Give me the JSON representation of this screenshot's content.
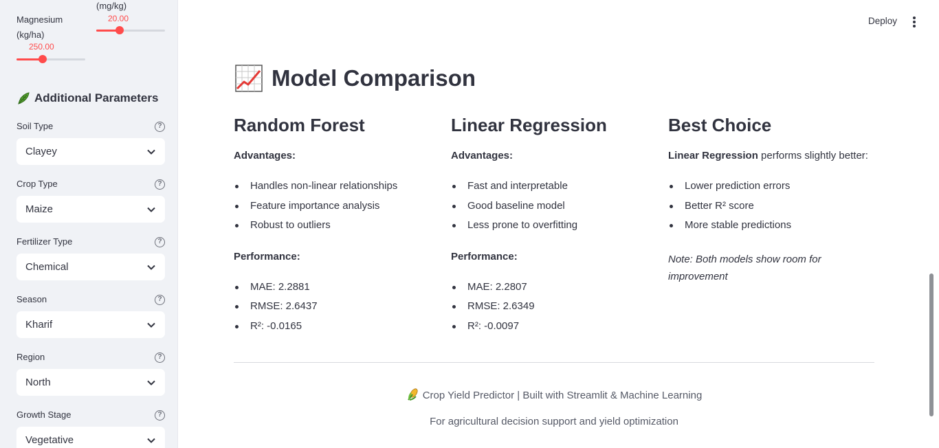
{
  "sidebar": {
    "sliders": [
      {
        "label_line1": "",
        "label_line2": "(mg/kg)",
        "value": "20.00",
        "fraction": 0.33
      },
      {
        "label_line1": "Magnesium",
        "label_line2": "(kg/ha)",
        "value": "250.00",
        "fraction": 0.38
      }
    ],
    "section_title": "Additional Parameters",
    "fields": [
      {
        "label": "Soil Type",
        "value": "Clayey"
      },
      {
        "label": "Crop Type",
        "value": "Maize"
      },
      {
        "label": "Fertilizer Type",
        "value": "Chemical"
      },
      {
        "label": "Season",
        "value": "Kharif"
      },
      {
        "label": "Region",
        "value": "North"
      },
      {
        "label": "Growth Stage",
        "value": "Vegetative"
      }
    ],
    "help_glyph": "?"
  },
  "header": {
    "deploy_label": "Deploy"
  },
  "main": {
    "title": "Model Comparison",
    "columns": [
      {
        "heading": "Random Forest",
        "advantages_label": "Advantages:",
        "advantages": [
          "Handles non-linear relationships",
          "Feature importance analysis",
          "Robust to outliers"
        ],
        "performance_label": "Performance:",
        "performance": [
          "MAE: 2.2881",
          "RMSE: 2.6437",
          "R²: -0.0165"
        ]
      },
      {
        "heading": "Linear Regression",
        "advantages_label": "Advantages:",
        "advantages": [
          "Fast and interpretable",
          "Good baseline model",
          "Less prone to overfitting"
        ],
        "performance_label": "Performance:",
        "performance": [
          "MAE: 2.2807",
          "RMSE: 2.6349",
          "R²: -0.0097"
        ]
      },
      {
        "heading": "Best Choice",
        "lead_bold": "Linear Regression",
        "lead_rest": " performs slightly better:",
        "points": [
          "Lower prediction errors",
          "Better R² score",
          "More stable predictions"
        ],
        "note": "Note: Both models show room for improvement"
      }
    ],
    "footer_line1": "Crop Yield Predictor | Built with Streamlit & Machine Learning",
    "footer_line2": "For agricultural decision support and yield optimization"
  },
  "colors": {
    "accent": "#ff4b4b",
    "sidebar_bg": "#f0f2f6",
    "text": "#31333f"
  }
}
